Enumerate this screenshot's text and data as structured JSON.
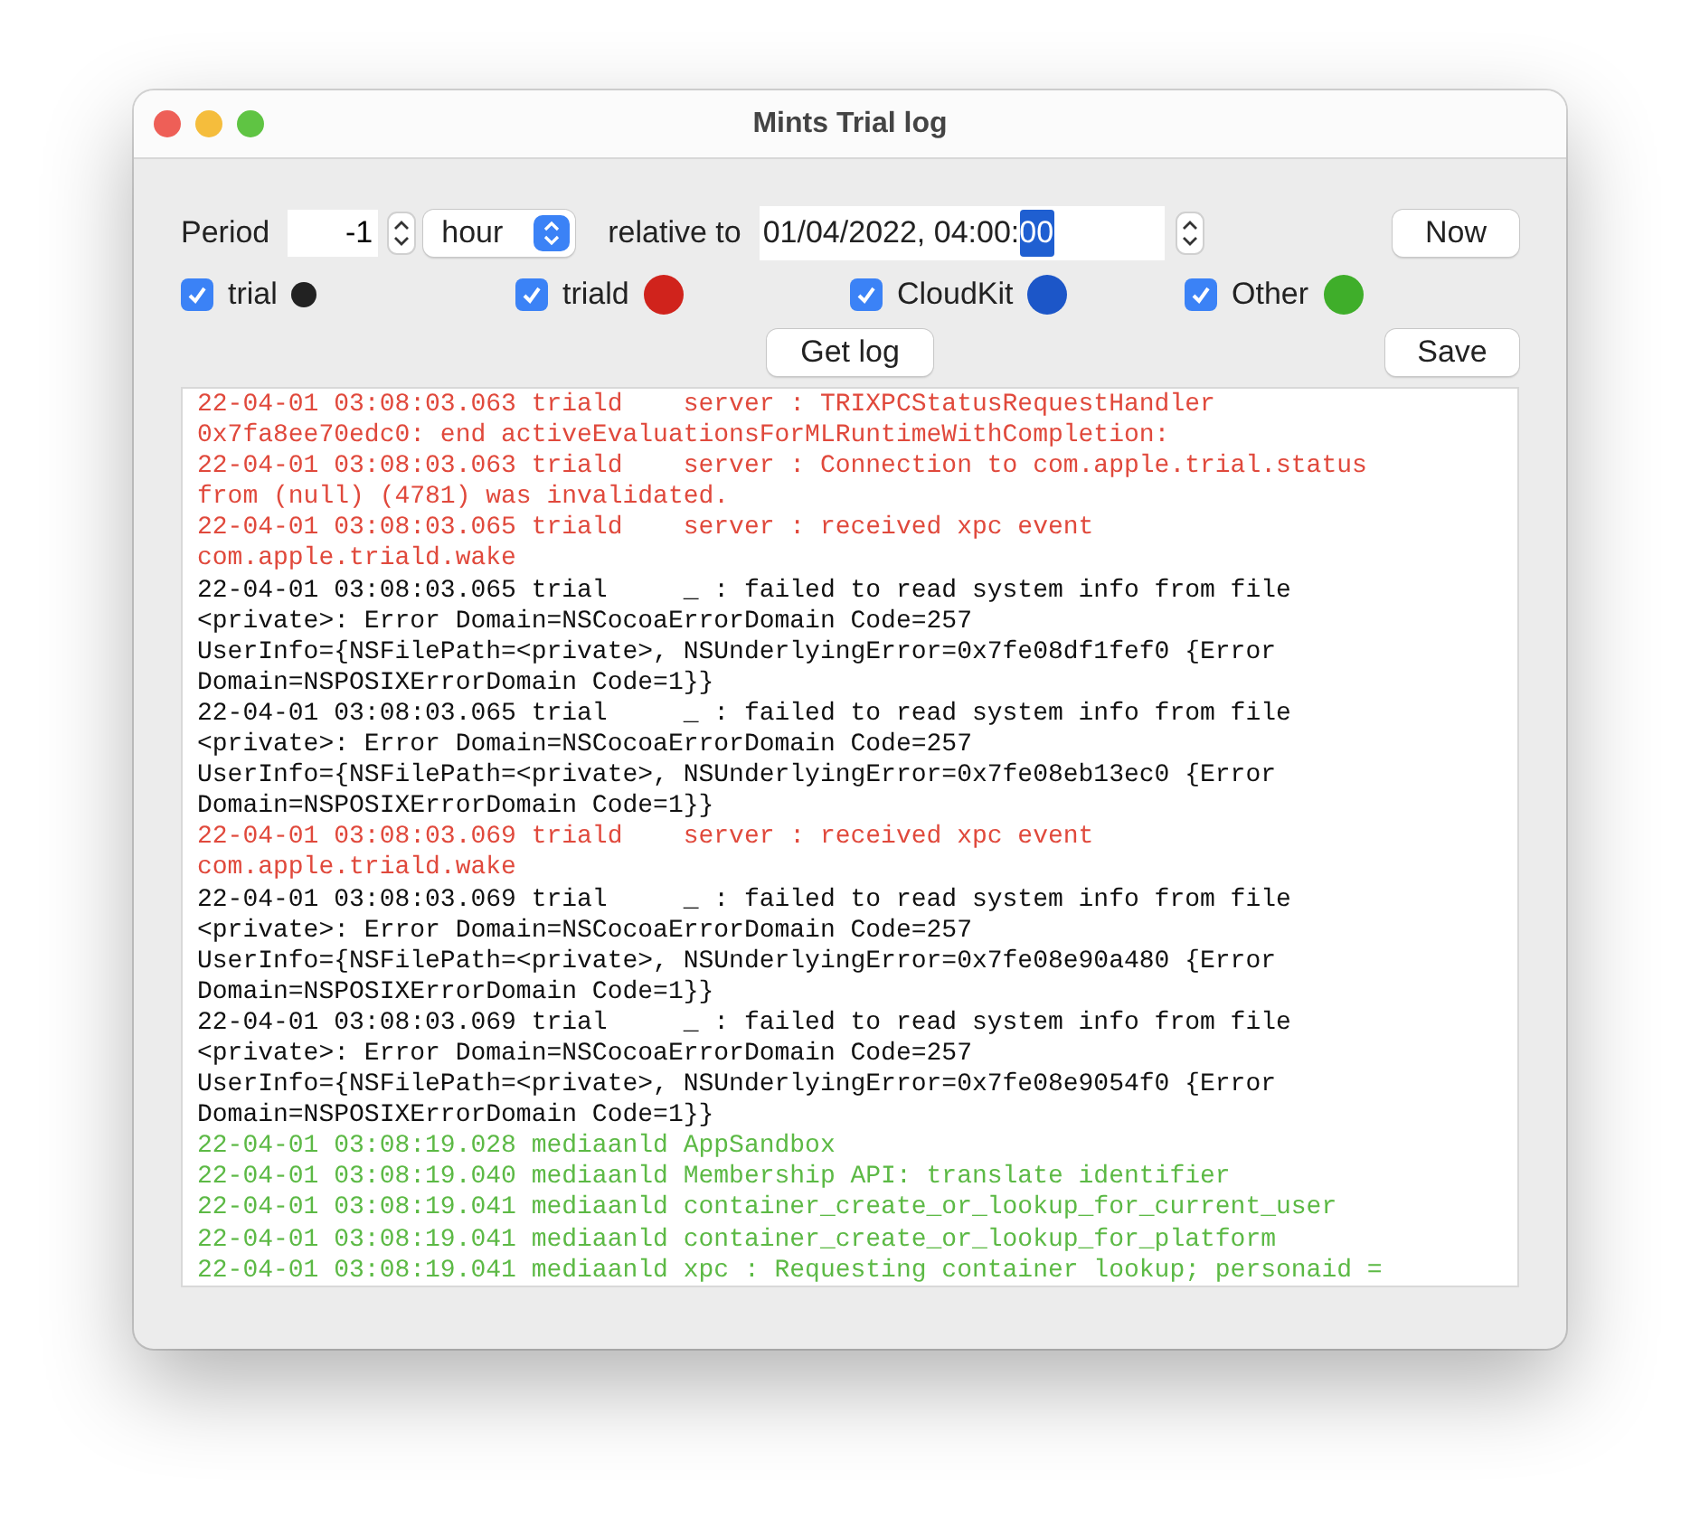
{
  "window": {
    "title": "Mints Trial log"
  },
  "period": {
    "label": "Period",
    "value": "-1",
    "unit": "hour",
    "relative_label": "relative to",
    "date_value": "01/04/2022, 04:00:",
    "date_selected_segment": "00",
    "now_button": "Now"
  },
  "filters": [
    {
      "label": "trial",
      "checked": true,
      "color": "#222222"
    },
    {
      "label": "triald",
      "checked": true,
      "color": "#d0231c"
    },
    {
      "label": "CloudKit",
      "checked": true,
      "color": "#1c56c8"
    },
    {
      "label": "Other",
      "checked": true,
      "color": "#3fae2a"
    }
  ],
  "buttons": {
    "get_log": "Get log",
    "save": "Save"
  },
  "log_lines": [
    {
      "text": "22-04-01 03:08:03.063 triald    server : TRIXPCStatusRequestHandler",
      "color": "#e0493c"
    },
    {
      "text": "0x7fa8ee70edc0: end activeEvaluationsForMLRuntimeWithCompletion:",
      "color": "#e0493c"
    },
    {
      "text": "22-04-01 03:08:03.063 triald    server : Connection to com.apple.trial.status",
      "color": "#e0493c"
    },
    {
      "text": "from (null) (4781) was invalidated.",
      "color": "#e0493c"
    },
    {
      "text": "22-04-01 03:08:03.065 triald    server : received xpc event",
      "color": "#e0493c"
    },
    {
      "text": "com.apple.triald.wake",
      "color": "#e0493c"
    },
    {
      "text": "22-04-01 03:08:03.065 trial     _ : failed to read system info from file",
      "color": "#111111"
    },
    {
      "text": "<private>: Error Domain=NSCocoaErrorDomain Code=257",
      "color": "#111111"
    },
    {
      "text": "UserInfo={NSFilePath=<private>, NSUnderlyingError=0x7fe08df1fef0 {Error",
      "color": "#111111"
    },
    {
      "text": "Domain=NSPOSIXErrorDomain Code=1}}",
      "color": "#111111"
    },
    {
      "text": "22-04-01 03:08:03.065 trial     _ : failed to read system info from file",
      "color": "#111111"
    },
    {
      "text": "<private>: Error Domain=NSCocoaErrorDomain Code=257",
      "color": "#111111"
    },
    {
      "text": "UserInfo={NSFilePath=<private>, NSUnderlyingError=0x7fe08eb13ec0 {Error",
      "color": "#111111"
    },
    {
      "text": "Domain=NSPOSIXErrorDomain Code=1}}",
      "color": "#111111"
    },
    {
      "text": "22-04-01 03:08:03.069 triald    server : received xpc event",
      "color": "#e0493c"
    },
    {
      "text": "com.apple.triald.wake",
      "color": "#e0493c"
    },
    {
      "text": "22-04-01 03:08:03.069 trial     _ : failed to read system info from file",
      "color": "#111111"
    },
    {
      "text": "<private>: Error Domain=NSCocoaErrorDomain Code=257",
      "color": "#111111"
    },
    {
      "text": "UserInfo={NSFilePath=<private>, NSUnderlyingError=0x7fe08e90a480 {Error",
      "color": "#111111"
    },
    {
      "text": "Domain=NSPOSIXErrorDomain Code=1}}",
      "color": "#111111"
    },
    {
      "text": "22-04-01 03:08:03.069 trial     _ : failed to read system info from file",
      "color": "#111111"
    },
    {
      "text": "<private>: Error Domain=NSCocoaErrorDomain Code=257",
      "color": "#111111"
    },
    {
      "text": "UserInfo={NSFilePath=<private>, NSUnderlyingError=0x7fe08e9054f0 {Error",
      "color": "#111111"
    },
    {
      "text": "Domain=NSPOSIXErrorDomain Code=1}}",
      "color": "#111111"
    },
    {
      "text": "22-04-01 03:08:19.028 mediaanld AppSandbox",
      "color": "#5cb945"
    },
    {
      "text": "22-04-01 03:08:19.040 mediaanld Membership API: translate identifier",
      "color": "#5cb945"
    },
    {
      "text": "22-04-01 03:08:19.041 mediaanld container_create_or_lookup_for_current_user",
      "color": "#5cb945"
    },
    {
      "text": "22-04-01 03:08:19.041 mediaanld container_create_or_lookup_for_platform",
      "color": "#5cb945"
    },
    {
      "text": "22-04-01 03:08:19.041 mediaanld xpc : Requesting container lookup; personaid =",
      "color": "#5cb945"
    }
  ]
}
